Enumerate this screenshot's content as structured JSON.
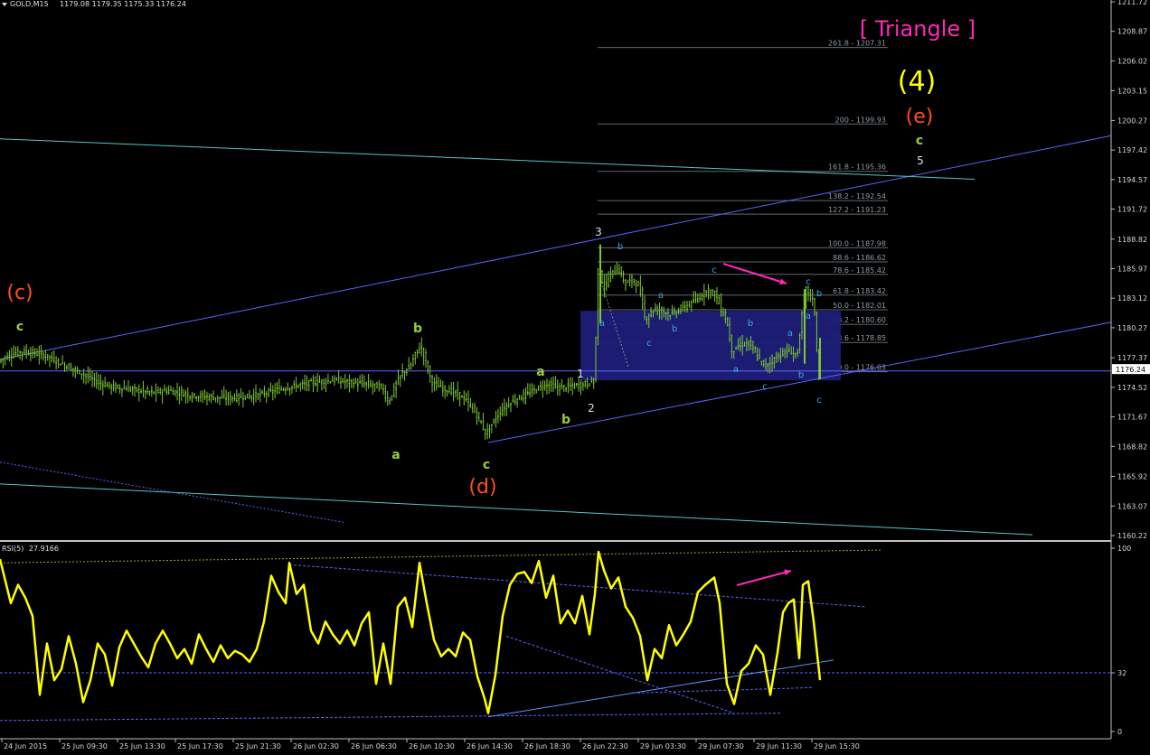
{
  "window": {
    "title": "GOLD,M15",
    "ohlc": "1179.08 1179.35 1175.33 1176.24"
  },
  "colors": {
    "background": "#000000",
    "candle": "#7ec832",
    "axis": "#c0c0c0",
    "channel": "#5a64ff",
    "trend": "#56c7c0",
    "fib": "#5e6a70",
    "box": "#1e1e78",
    "rsi": "#ffff00",
    "magenta": "#ff2ab7",
    "wave_green": "#9ccc3a",
    "wave_orange": "#ff4e1a",
    "wave_yellow": "#ffff00",
    "wave_cyan": "#3aa8e0",
    "wave_white": "#e0e0e0"
  },
  "chart_data": [
    {
      "type": "candlestick",
      "symbol": "GOLD",
      "timeframe": "M15",
      "ylim": [
        1160.22,
        1211.72
      ],
      "y_ticks": [
        "1211.72",
        "1208.87",
        "1206.02",
        "1203.15",
        "1200.27",
        "1197.42",
        "1194.57",
        "1191.72",
        "1188.82",
        "1185.97",
        "1183.12",
        "1180.27",
        "1177.37",
        "1174.52",
        "1171.67",
        "1168.82",
        "1165.92",
        "1163.07",
        "1160.22"
      ],
      "x_ticks": [
        "24 Jun 2015",
        "25 Jun 09:30",
        "25 Jun 13:30",
        "25 Jun 17:30",
        "25 Jun 21:30",
        "26 Jun 02:30",
        "26 Jun 06:30",
        "26 Jun 10:30",
        "26 Jun 14:30",
        "26 Jun 18:30",
        "26 Jun 22:30",
        "29 Jun 03:30",
        "29 Jun 07:30",
        "29 Jun 11:30",
        "29 Jun 15:30"
      ],
      "current_price": "1176.24",
      "price_path": [
        [
          0,
          1177.0
        ],
        [
          10,
          1177.5
        ],
        [
          25,
          1178.0
        ],
        [
          40,
          1177.8
        ],
        [
          55,
          1177.5
        ],
        [
          70,
          1176.8
        ],
        [
          90,
          1176.0
        ],
        [
          110,
          1175.0
        ],
        [
          130,
          1174.5
        ],
        [
          150,
          1174.3
        ],
        [
          170,
          1174.0
        ],
        [
          190,
          1174.2
        ],
        [
          210,
          1173.8
        ],
        [
          230,
          1173.6
        ],
        [
          250,
          1173.5
        ],
        [
          270,
          1173.6
        ],
        [
          290,
          1173.8
        ],
        [
          310,
          1174.3
        ],
        [
          330,
          1174.7
        ],
        [
          350,
          1175.0
        ],
        [
          370,
          1175.2
        ],
        [
          390,
          1175.0
        ],
        [
          410,
          1174.8
        ],
        [
          425,
          1174.5
        ],
        [
          432,
          1173.0
        ],
        [
          440,
          1174.8
        ],
        [
          448,
          1176.0
        ],
        [
          456,
          1176.5
        ],
        [
          463,
          1178.0
        ],
        [
          468,
          1178.5
        ],
        [
          475,
          1176.5
        ],
        [
          480,
          1175.0
        ],
        [
          490,
          1174.5
        ],
        [
          505,
          1174.0
        ],
        [
          515,
          1173.5
        ],
        [
          525,
          1172.5
        ],
        [
          532,
          1171.5
        ],
        [
          540,
          1170.0
        ],
        [
          548,
          1171.2
        ],
        [
          556,
          1172.2
        ],
        [
          566,
          1173.0
        ],
        [
          576,
          1173.5
        ],
        [
          588,
          1174.0
        ],
        [
          598,
          1174.5
        ],
        [
          608,
          1174.8
        ],
        [
          620,
          1174.5
        ],
        [
          632,
          1174.6
        ],
        [
          645,
          1174.8
        ],
        [
          655,
          1175.0
        ],
        [
          660,
          1175.3
        ],
        [
          664,
          1187.0
        ],
        [
          670,
          1184.0
        ],
        [
          678,
          1185.5
        ],
        [
          686,
          1186.0
        ],
        [
          694,
          1184.5
        ],
        [
          702,
          1185.0
        ],
        [
          710,
          1184.0
        ],
        [
          716,
          1181.0
        ],
        [
          724,
          1182.0
        ],
        [
          734,
          1182.0
        ],
        [
          744,
          1181.5
        ],
        [
          754,
          1182.0
        ],
        [
          764,
          1182.5
        ],
        [
          774,
          1183.0
        ],
        [
          784,
          1184.0
        ],
        [
          794,
          1183.5
        ],
        [
          800,
          1182.0
        ],
        [
          806,
          1181.0
        ],
        [
          812,
          1178.0
        ],
        [
          820,
          1178.5
        ],
        [
          830,
          1178.8
        ],
        [
          840,
          1177.5
        ],
        [
          848,
          1176.5
        ],
        [
          856,
          1177.0
        ],
        [
          866,
          1177.8
        ],
        [
          876,
          1178.0
        ],
        [
          884,
          1177.5
        ],
        [
          890,
          1182.0
        ],
        [
          894,
          1184.0
        ],
        [
          898,
          1183.5
        ],
        [
          903,
          1182.5
        ],
        [
          907,
          1176.0
        ]
      ]
    },
    {
      "type": "line",
      "indicator": "RSI(5)",
      "value": "27.9166",
      "ylim": [
        0,
        100
      ],
      "y_ticks": [
        "100",
        "32",
        "0"
      ],
      "levels": [
        32
      ],
      "series": [
        [
          0,
          94
        ],
        [
          12,
          70
        ],
        [
          20,
          80
        ],
        [
          28,
          73
        ],
        [
          36,
          63
        ],
        [
          44,
          20
        ],
        [
          52,
          48
        ],
        [
          60,
          28
        ],
        [
          68,
          34
        ],
        [
          76,
          52
        ],
        [
          84,
          37
        ],
        [
          92,
          16
        ],
        [
          100,
          28
        ],
        [
          108,
          48
        ],
        [
          116,
          42
        ],
        [
          124,
          25
        ],
        [
          132,
          46
        ],
        [
          140,
          55
        ],
        [
          148,
          48
        ],
        [
          156,
          41
        ],
        [
          164,
          35
        ],
        [
          172,
          48
        ],
        [
          180,
          55
        ],
        [
          188,
          48
        ],
        [
          196,
          40
        ],
        [
          204,
          45
        ],
        [
          212,
          37
        ],
        [
          220,
          53
        ],
        [
          228,
          45
        ],
        [
          236,
          38
        ],
        [
          244,
          47
        ],
        [
          252,
          40
        ],
        [
          260,
          44
        ],
        [
          268,
          42
        ],
        [
          276,
          38
        ],
        [
          284,
          45
        ],
        [
          292,
          60
        ],
        [
          300,
          85
        ],
        [
          308,
          76
        ],
        [
          316,
          70
        ],
        [
          320,
          92
        ],
        [
          328,
          75
        ],
        [
          336,
          80
        ],
        [
          344,
          55
        ],
        [
          352,
          48
        ],
        [
          360,
          60
        ],
        [
          368,
          53
        ],
        [
          376,
          48
        ],
        [
          384,
          55
        ],
        [
          392,
          47
        ],
        [
          400,
          59
        ],
        [
          408,
          65
        ],
        [
          416,
          26
        ],
        [
          424,
          48
        ],
        [
          432,
          26
        ],
        [
          440,
          68
        ],
        [
          448,
          73
        ],
        [
          456,
          57
        ],
        [
          464,
          92
        ],
        [
          472,
          70
        ],
        [
          480,
          50
        ],
        [
          488,
          41
        ],
        [
          496,
          45
        ],
        [
          504,
          41
        ],
        [
          512,
          54
        ],
        [
          520,
          50
        ],
        [
          528,
          30
        ],
        [
          536,
          18
        ],
        [
          540,
          10
        ],
        [
          548,
          31
        ],
        [
          556,
          63
        ],
        [
          564,
          80
        ],
        [
          572,
          86
        ],
        [
          580,
          87
        ],
        [
          588,
          81
        ],
        [
          596,
          93
        ],
        [
          604,
          73
        ],
        [
          612,
          85
        ],
        [
          620,
          59
        ],
        [
          628,
          66
        ],
        [
          636,
          59
        ],
        [
          644,
          74
        ],
        [
          652,
          53
        ],
        [
          658,
          75
        ],
        [
          662,
          98
        ],
        [
          668,
          88
        ],
        [
          676,
          78
        ],
        [
          684,
          84
        ],
        [
          692,
          68
        ],
        [
          700,
          62
        ],
        [
          708,
          52
        ],
        [
          716,
          28
        ],
        [
          724,
          45
        ],
        [
          732,
          40
        ],
        [
          740,
          58
        ],
        [
          748,
          47
        ],
        [
          756,
          53
        ],
        [
          764,
          60
        ],
        [
          772,
          76
        ],
        [
          780,
          80
        ],
        [
          790,
          84
        ],
        [
          796,
          70
        ],
        [
          804,
          26
        ],
        [
          812,
          15
        ],
        [
          820,
          33
        ],
        [
          828,
          37
        ],
        [
          836,
          47
        ],
        [
          844,
          42
        ],
        [
          852,
          20
        ],
        [
          860,
          43
        ],
        [
          866,
          65
        ],
        [
          872,
          70
        ],
        [
          878,
          72
        ],
        [
          884,
          40
        ],
        [
          888,
          80
        ],
        [
          894,
          82
        ],
        [
          900,
          60
        ],
        [
          907,
          28
        ]
      ]
    }
  ],
  "labels": {
    "triangle": "[ Triangle ]",
    "wave_4": "(4)",
    "wave_e": "(e)",
    "wave_c_upper": "c",
    "wave_5": "5",
    "wave_c_left_paren": "(c)",
    "wave_c_left": "c",
    "wave_b_mid": "b",
    "wave_a_mid": "a",
    "wave_c_bottom": "c",
    "wave_d_paren": "(d)",
    "wave_a_small": "a",
    "wave_b_small": "b",
    "wave_1": "1",
    "wave_2": "2",
    "wave_3": "3",
    "cyan_a1": "a",
    "cyan_b1": "b",
    "cyan_c1": "c",
    "cyan_a2": "a",
    "cyan_b2": "b",
    "cyan_c2": "c",
    "cyan_a3": "a",
    "cyan_b3": "b",
    "cyan_c3": "c",
    "cyan_a4": "a",
    "cyan_b4": "b",
    "cyan_c4": "c",
    "cyan_a5": "a",
    "cyan_b5": "b",
    "cyan_c5": "c"
  },
  "fib_levels": [
    "261.8 - 1207.31",
    "200 - 1199.93",
    "161.8 - 1195.36",
    "138.2 - 1192.54",
    "127.2 - 1191.23",
    "100.0 - 1187.98",
    "88.6 - 1186.62",
    "78.6 - 1185.42",
    "61.8 - 1183.42",
    "50.0 - 1182.01",
    "38.2 - 1180.60",
    "23.6 - 1178.85",
    "0.0 - 1176.03"
  ]
}
